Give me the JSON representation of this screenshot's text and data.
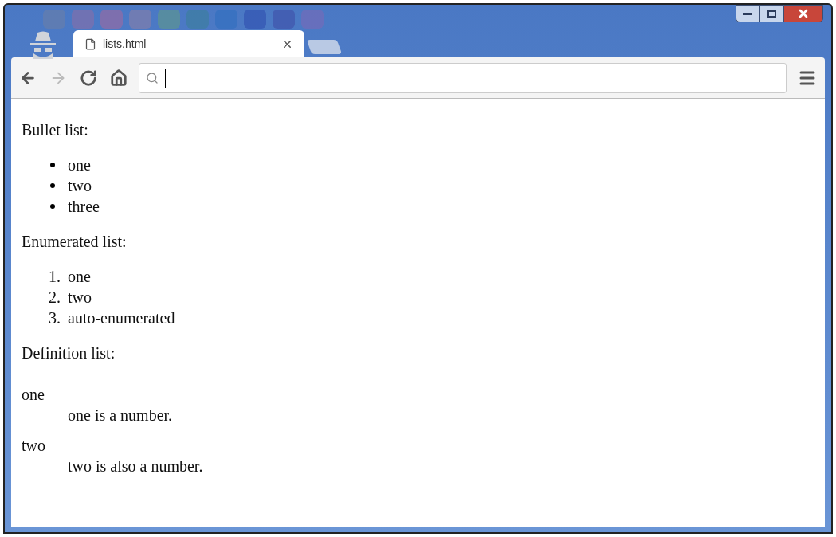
{
  "tab": {
    "title": "lists.html"
  },
  "content": {
    "sections": [
      {
        "kind": "bullets",
        "heading": "Bullet list:",
        "items": [
          "one",
          "two",
          "three"
        ]
      },
      {
        "kind": "numbered",
        "heading": "Enumerated list:",
        "items": [
          {
            "marker": "1.",
            "text": "one"
          },
          {
            "marker": "2.",
            "text": "two"
          },
          {
            "marker": "3.",
            "text": "auto-enumerated"
          }
        ]
      },
      {
        "kind": "definitions",
        "heading": "Definition list:",
        "items": [
          {
            "term": "one",
            "definition": "one is a number."
          },
          {
            "term": "two",
            "definition": "two is also a number."
          }
        ]
      }
    ]
  }
}
